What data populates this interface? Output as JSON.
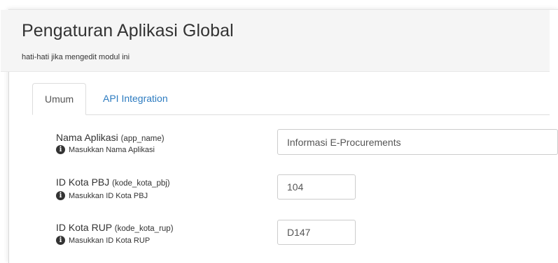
{
  "header": {
    "title": "Pengaturan Aplikasi Global",
    "subtitle": "hati-hati jika mengedit modul ini"
  },
  "tabs": [
    {
      "label": "Umum",
      "active": true
    },
    {
      "label": "API Integration",
      "active": false
    }
  ],
  "fields": [
    {
      "label": "Nama Aplikasi",
      "key": "(app_name)",
      "hint": "Masukkan Nama Aplikasi",
      "value": "Informasi E-Procurements"
    },
    {
      "label": "ID Kota PBJ",
      "key": "(kode_kota_pbj)",
      "hint": "Masukkan ID Kota PBJ",
      "value": "104"
    },
    {
      "label": "ID Kota RUP",
      "key": "(kode_kota_rup)",
      "hint": "Masukkan ID Kota RUP",
      "value": "D147"
    }
  ],
  "icons": {
    "hint": "info-circle-icon"
  },
  "colors": {
    "link": "#2c7bc0",
    "header_bg": "#f5f5f5"
  }
}
